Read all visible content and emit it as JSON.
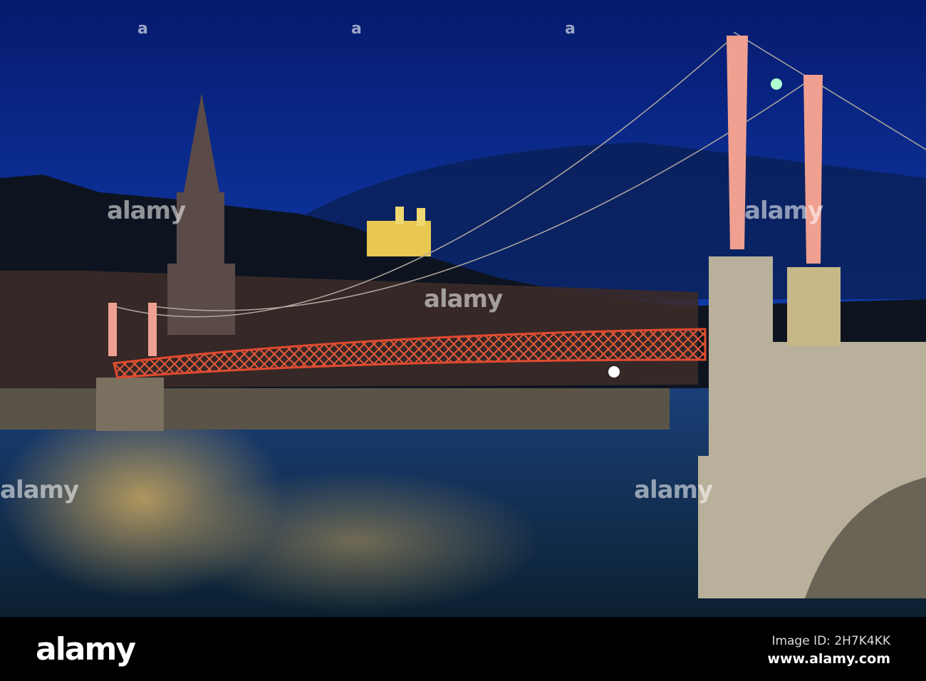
{
  "watermark": {
    "text": "alamy",
    "mark": "a"
  },
  "footer": {
    "logo": "alamy",
    "image_id": "Image ID: 2H7K4KK",
    "url": "www.alamy.com"
  },
  "colors": {
    "sky_top": "#061a6e",
    "sky_bottom": "#1d55c8",
    "bridge": "#d8402a",
    "pylon": "#f0a090",
    "stone": "#b8b09a",
    "water": "#0d2a4a"
  }
}
